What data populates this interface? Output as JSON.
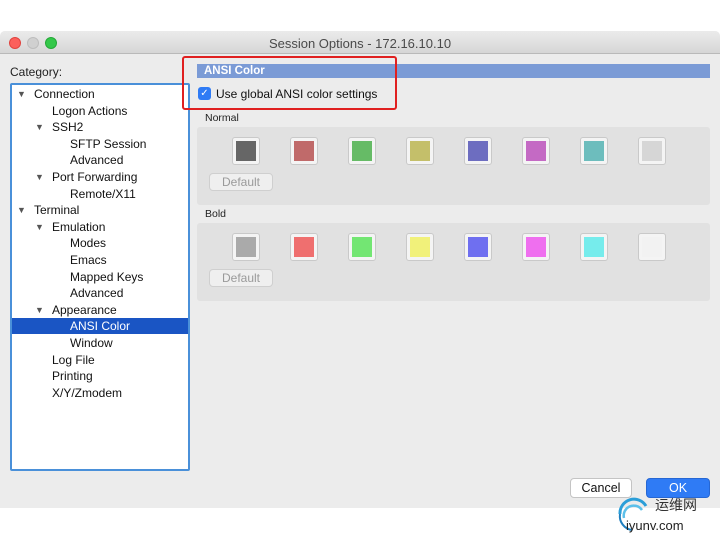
{
  "window": {
    "title": "Session Options - 172.16.10.10"
  },
  "category": {
    "label": "Category:",
    "items": [
      {
        "label": "Connection",
        "expandable": true,
        "expanded": true,
        "selected": false
      },
      {
        "label": "Logon Actions",
        "expandable": false,
        "expanded": false,
        "selected": false
      },
      {
        "label": "SSH2",
        "expandable": true,
        "expanded": true,
        "selected": false
      },
      {
        "label": "SFTP Session",
        "expandable": false,
        "expanded": false,
        "selected": false
      },
      {
        "label": "Advanced",
        "expandable": false,
        "expanded": false,
        "selected": false
      },
      {
        "label": "Port Forwarding",
        "expandable": true,
        "expanded": true,
        "selected": false
      },
      {
        "label": "Remote/X11",
        "expandable": false,
        "expanded": false,
        "selected": false
      },
      {
        "label": "Terminal",
        "expandable": true,
        "expanded": true,
        "selected": false
      },
      {
        "label": "Emulation",
        "expandable": true,
        "expanded": true,
        "selected": false
      },
      {
        "label": "Modes",
        "expandable": false,
        "expanded": false,
        "selected": false
      },
      {
        "label": "Emacs",
        "expandable": false,
        "expanded": false,
        "selected": false
      },
      {
        "label": "Mapped Keys",
        "expandable": false,
        "expanded": false,
        "selected": false
      },
      {
        "label": "Advanced",
        "expandable": false,
        "expanded": false,
        "selected": false
      },
      {
        "label": "Appearance",
        "expandable": true,
        "expanded": true,
        "selected": false
      },
      {
        "label": "ANSI Color",
        "expandable": false,
        "expanded": false,
        "selected": true
      },
      {
        "label": "Window",
        "expandable": false,
        "expanded": false,
        "selected": false
      },
      {
        "label": "Log File",
        "expandable": false,
        "expanded": false,
        "selected": false
      },
      {
        "label": "Printing",
        "expandable": false,
        "expanded": false,
        "selected": false
      },
      {
        "label": "X/Y/Zmodem",
        "expandable": false,
        "expanded": false,
        "selected": false
      }
    ]
  },
  "panel": {
    "title": "ANSI Color",
    "global_checkbox": {
      "label": "Use global ANSI color settings",
      "checked": true
    },
    "normal": {
      "label": "Normal",
      "default_label": "Default",
      "colors": [
        "#666666",
        "#c06a6a",
        "#66bb66",
        "#c4bf6a",
        "#6d6dc0",
        "#c46ac4",
        "#6dbdbd",
        "#d6d6d6"
      ]
    },
    "bold": {
      "label": "Bold",
      "default_label": "Default",
      "colors": [
        "#aaaaaa",
        "#ef6f6f",
        "#73e673",
        "#f1f17a",
        "#6f6ff0",
        "#ef6fef",
        "#76ecec",
        "#f2f2f2"
      ]
    }
  },
  "buttons": {
    "cancel": "Cancel",
    "ok": "OK"
  },
  "watermark": {
    "chinese": "运维网",
    "url": "iyunv.com"
  }
}
